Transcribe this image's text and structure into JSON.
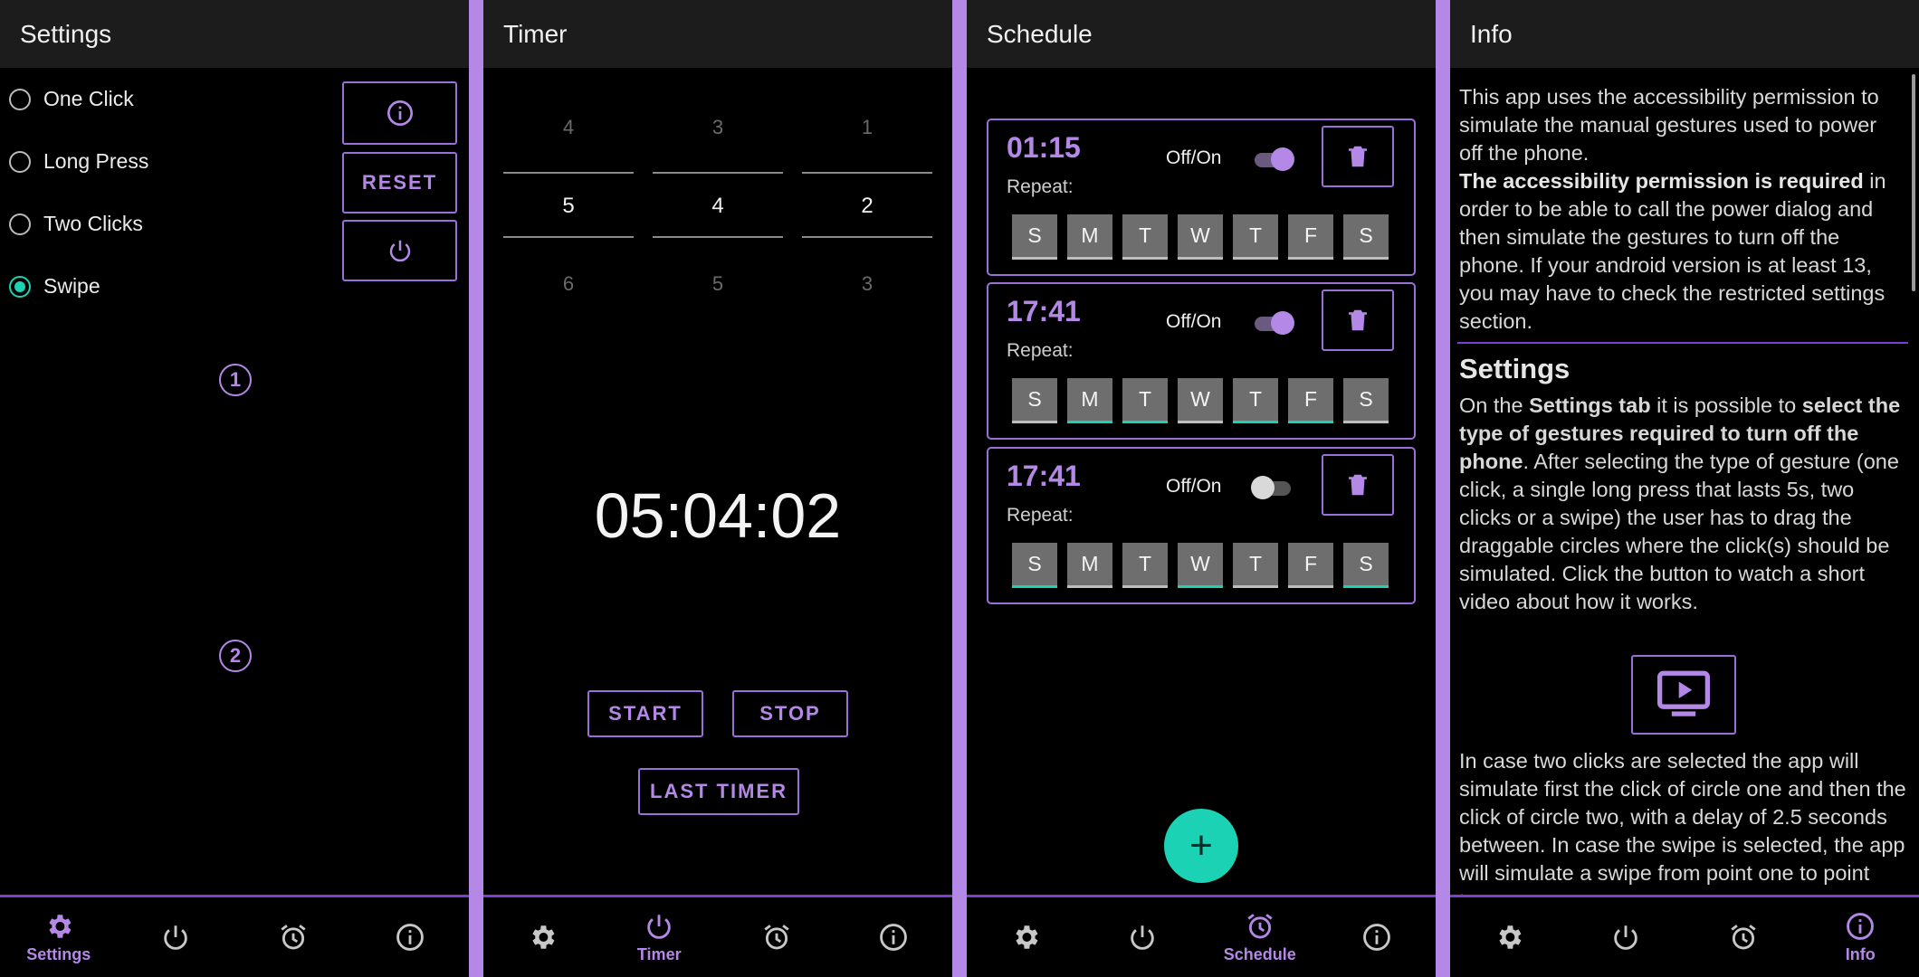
{
  "colors": {
    "accent": "#b488e6",
    "teal": "#1bd3b4",
    "divider": "#7a3fd0"
  },
  "nav": {
    "settings_label": "Settings",
    "timer_label": "Timer",
    "schedule_label": "Schedule",
    "info_label": "Info",
    "icons": [
      "gear-icon",
      "power-icon",
      "alarm-icon",
      "info-icon"
    ]
  },
  "settings": {
    "title": "Settings",
    "options": [
      {
        "label": "One Click",
        "selected": false
      },
      {
        "label": "Long Press",
        "selected": false
      },
      {
        "label": "Two Clicks",
        "selected": false
      },
      {
        "label": "Swipe",
        "selected": true
      }
    ],
    "reset_label": "RESET",
    "circle_one": "1",
    "circle_two": "2"
  },
  "timer": {
    "title": "Timer",
    "pickers": [
      {
        "above": "4",
        "selected": "5",
        "below": "6"
      },
      {
        "above": "3",
        "selected": "4",
        "below": "5"
      },
      {
        "above": "1",
        "selected": "2",
        "below": "3"
      }
    ],
    "countdown": "05:04:02",
    "start_label": "START",
    "stop_label": "STOP",
    "last_timer_label": "LAST TIMER"
  },
  "schedule": {
    "title": "Schedule",
    "repeat_label": "Repeat:",
    "toggle_label": "Off/On",
    "day_letters": [
      "S",
      "M",
      "T",
      "W",
      "T",
      "F",
      "S"
    ],
    "alarms": [
      {
        "time": "01:15",
        "enabled": true,
        "days": [
          false,
          false,
          false,
          false,
          false,
          false,
          false
        ]
      },
      {
        "time": "17:41",
        "enabled": true,
        "days": [
          false,
          true,
          true,
          false,
          true,
          true,
          false
        ]
      },
      {
        "time": "17:41",
        "enabled": false,
        "days": [
          true,
          false,
          false,
          true,
          false,
          false,
          true
        ]
      }
    ],
    "add_label": "+"
  },
  "info": {
    "title": "Info",
    "p1_a": "This app uses the accessibility permission to simulate the manual gestures used to power off the phone.",
    "p1_b": "The accessibility permission is required",
    "p1_c": " in order to be able to call the power dialog and then simulate the gestures to turn off the phone. If your android version is at least 13, you may have to check the restricted settings section.",
    "heading": "Settings",
    "p2_a": "On the ",
    "p2_b": "Settings tab",
    "p2_c": " it is possible to ",
    "p2_d": "select the type of gestures required to turn off the phone",
    "p2_e": ". After selecting the type of gesture (one click, a single long press that lasts 5s, two clicks or a swipe) the user has to drag the draggable circles where the click(s) should be simulated. Click the button to watch a short video about how it works.",
    "p3": "In case two clicks are selected the app will simulate first the click of circle one and then the click of circle two, with a delay of 2.5 seconds between. In case the swipe is selected, the app will simulate a swipe from point one to point two."
  }
}
